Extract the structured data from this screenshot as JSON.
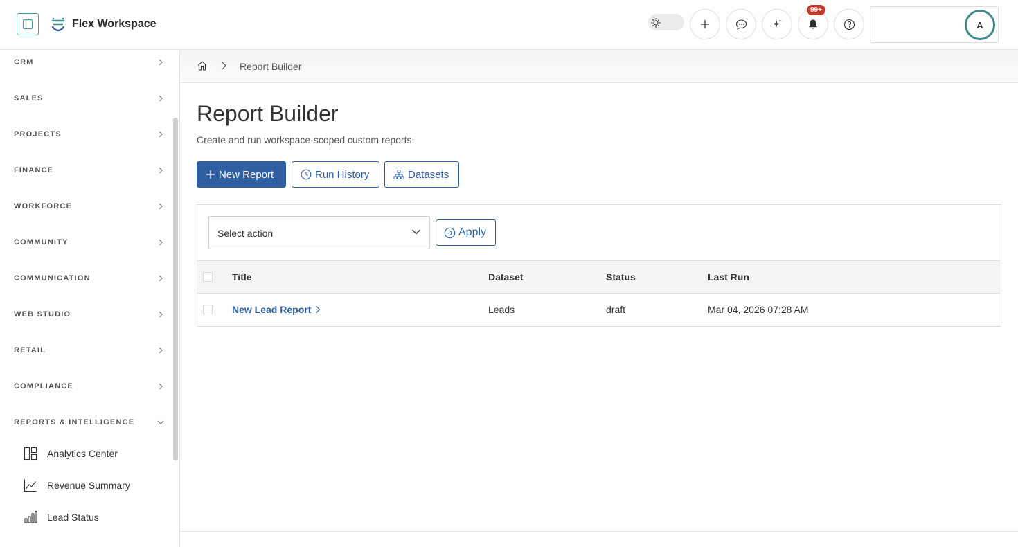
{
  "header": {
    "app_title": "Flex Workspace",
    "notification_badge": "99+",
    "avatar_initial": "A"
  },
  "sidebar": {
    "sections": [
      {
        "label": "CRM"
      },
      {
        "label": "SALES"
      },
      {
        "label": "PROJECTS"
      },
      {
        "label": "FINANCE"
      },
      {
        "label": "WORKFORCE"
      },
      {
        "label": "COMMUNITY"
      },
      {
        "label": "COMMUNICATION"
      },
      {
        "label": "WEB STUDIO"
      },
      {
        "label": "RETAIL"
      },
      {
        "label": "COMPLIANCE"
      },
      {
        "label": "REPORTS & INTELLIGENCE"
      }
    ],
    "sub_items": [
      {
        "label": "Analytics Center",
        "icon": "layout-icon"
      },
      {
        "label": "Revenue Summary",
        "icon": "line-chart-icon"
      },
      {
        "label": "Lead Status",
        "icon": "bar-chart-icon"
      }
    ]
  },
  "breadcrumb": {
    "current": "Report Builder"
  },
  "main": {
    "title": "Report Builder",
    "subtitle": "Create and run workspace-scoped custom reports.",
    "buttons": {
      "new_report": "New Report",
      "run_history": "Run History",
      "datasets": "Datasets"
    },
    "bulk": {
      "select_value": "Select action",
      "apply": "Apply"
    },
    "table": {
      "columns": [
        "Title",
        "Dataset",
        "Status",
        "Last Run"
      ],
      "rows": [
        {
          "title": "New Lead Report",
          "dataset": "Leads",
          "status": "draft",
          "last_run": "Mar 04, 2026 07:28 AM"
        }
      ]
    }
  },
  "colors": {
    "primary": "#2f5fa0",
    "accent_teal": "#3f8a8c",
    "badge_red": "#c0392b"
  }
}
